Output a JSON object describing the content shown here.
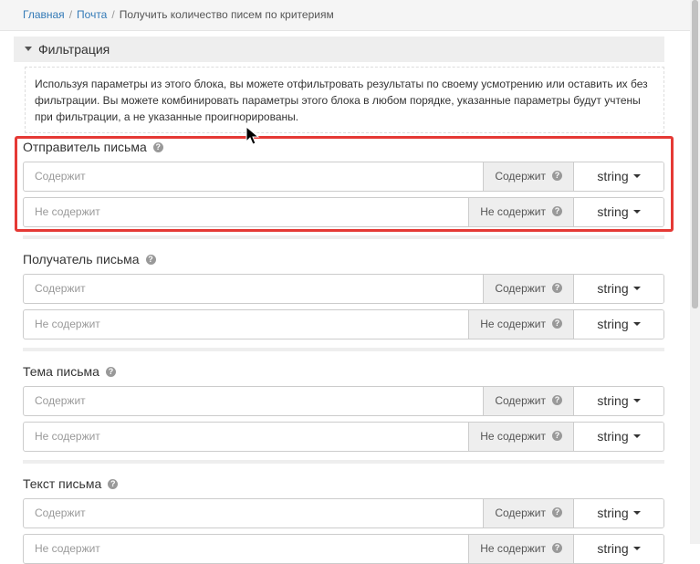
{
  "breadcrumb": {
    "home": "Главная",
    "mail": "Почта",
    "current": "Получить количество писем по критериям"
  },
  "filter": {
    "title": "Фильтрация",
    "note_lines": [
      "Используя параметры из этого блока, вы можете отфильтровать результаты по своему усмотрению или оставить их без",
      "фильтрации. Вы можете комбинировать параметры этого блока в любом порядке, указанные параметры будут учтены",
      "при фильтрации, а не указанные проигнорированы."
    ]
  },
  "sections": [
    {
      "label": "Отправитель письма",
      "rows": [
        {
          "placeholder": "Содержит",
          "addon": "Содержит",
          "type": "string"
        },
        {
          "placeholder": "Не содержит",
          "addon": "Не содержит",
          "type": "string"
        }
      ]
    },
    {
      "label": "Получатель письма",
      "rows": [
        {
          "placeholder": "Содержит",
          "addon": "Содержит",
          "type": "string"
        },
        {
          "placeholder": "Не содержит",
          "addon": "Не содержит",
          "type": "string"
        }
      ]
    },
    {
      "label": "Тема письма",
      "rows": [
        {
          "placeholder": "Содержит",
          "addon": "Содержит",
          "type": "string"
        },
        {
          "placeholder": "Не содержит",
          "addon": "Не содержит",
          "type": "string"
        }
      ]
    },
    {
      "label": "Текст письма",
      "rows": [
        {
          "placeholder": "Содержит",
          "addon": "Содержит",
          "type": "string"
        },
        {
          "placeholder": "Не содержит",
          "addon": "Не содержит",
          "type": "string"
        }
      ]
    }
  ],
  "help_glyph": "?",
  "colors": {
    "link": "#337ab7",
    "highlight_border": "#e53935",
    "addon_bg": "#eeeeee"
  }
}
